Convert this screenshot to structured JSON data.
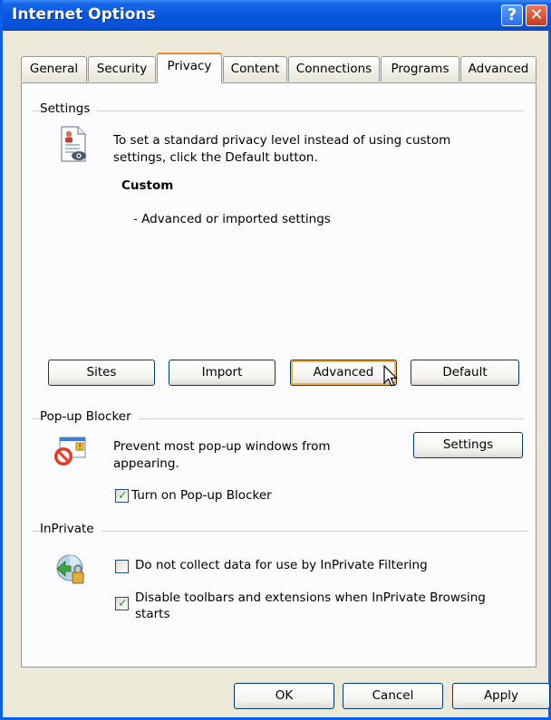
{
  "window": {
    "title": "Internet Options"
  },
  "tabs": [
    "General",
    "Security",
    "Privacy",
    "Content",
    "Connections",
    "Programs",
    "Advanced"
  ],
  "active_tab": "Privacy",
  "settings": {
    "group_label": "Settings",
    "description": "To set a standard privacy level instead of using custom settings, click the Default button.",
    "level_name": "Custom",
    "level_detail": "- Advanced or imported settings",
    "buttons": {
      "sites": "Sites",
      "import": "Import",
      "advanced": "Advanced",
      "default": "Default"
    }
  },
  "popup_blocker": {
    "group_label": "Pop-up Blocker",
    "description_line1": "Prevent most pop-up windows from",
    "description_line2": "appearing.",
    "settings_button": "Settings",
    "checkbox_label": "Turn on Pop-up Blocker",
    "checked": true
  },
  "inprivate": {
    "group_label": "InPrivate",
    "option1_label": "Do not collect data for use by InPrivate Filtering",
    "option1_checked": false,
    "option2_line1": "Disable toolbars and extensions when InPrivate Browsing",
    "option2_line2": "starts",
    "option2_checked": true
  },
  "footer": {
    "ok": "OK",
    "cancel": "Cancel",
    "apply": "Apply"
  },
  "colors": {
    "titlebar": "#0a56df",
    "face": "#ece9d8",
    "focus": "#f8b33b",
    "check": "#21a121"
  },
  "icons": [
    "help-icon",
    "close-icon",
    "privacy-document-icon",
    "popup-blocker-icon",
    "inprivate-icon",
    "mouse-cursor-icon"
  ]
}
